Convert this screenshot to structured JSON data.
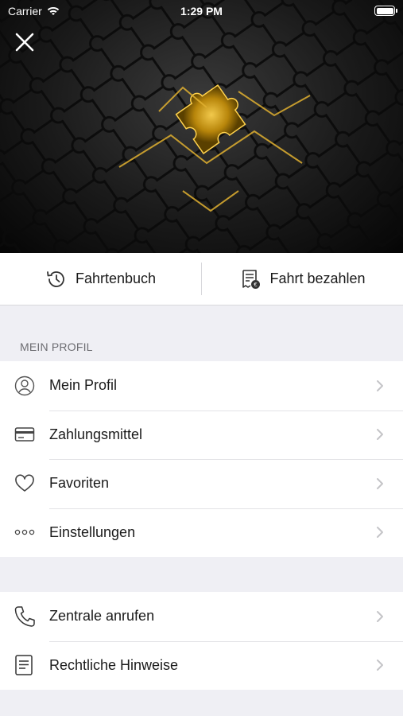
{
  "status_bar": {
    "carrier": "Carrier",
    "time": "1:29 PM"
  },
  "quick_actions": [
    {
      "label": "Fahrtenbuch",
      "icon": "history-icon"
    },
    {
      "label": "Fahrt bezahlen",
      "icon": "pay-ride-icon"
    }
  ],
  "sections": {
    "profile_header": "MEIN PROFIL"
  },
  "menu_group_1": [
    {
      "label": "Mein Profil",
      "icon": "user-icon"
    },
    {
      "label": "Zahlungsmittel",
      "icon": "credit-card-icon"
    },
    {
      "label": "Favoriten",
      "icon": "heart-icon"
    },
    {
      "label": "Einstellungen",
      "icon": "more-dots-icon"
    }
  ],
  "menu_group_2": [
    {
      "label": "Zentrale anrufen",
      "icon": "phone-icon"
    },
    {
      "label": "Rechtliche Hinweise",
      "icon": "document-icon"
    }
  ],
  "colors": {
    "accent_gold": "#d9a92a",
    "background": "#efeff4"
  }
}
